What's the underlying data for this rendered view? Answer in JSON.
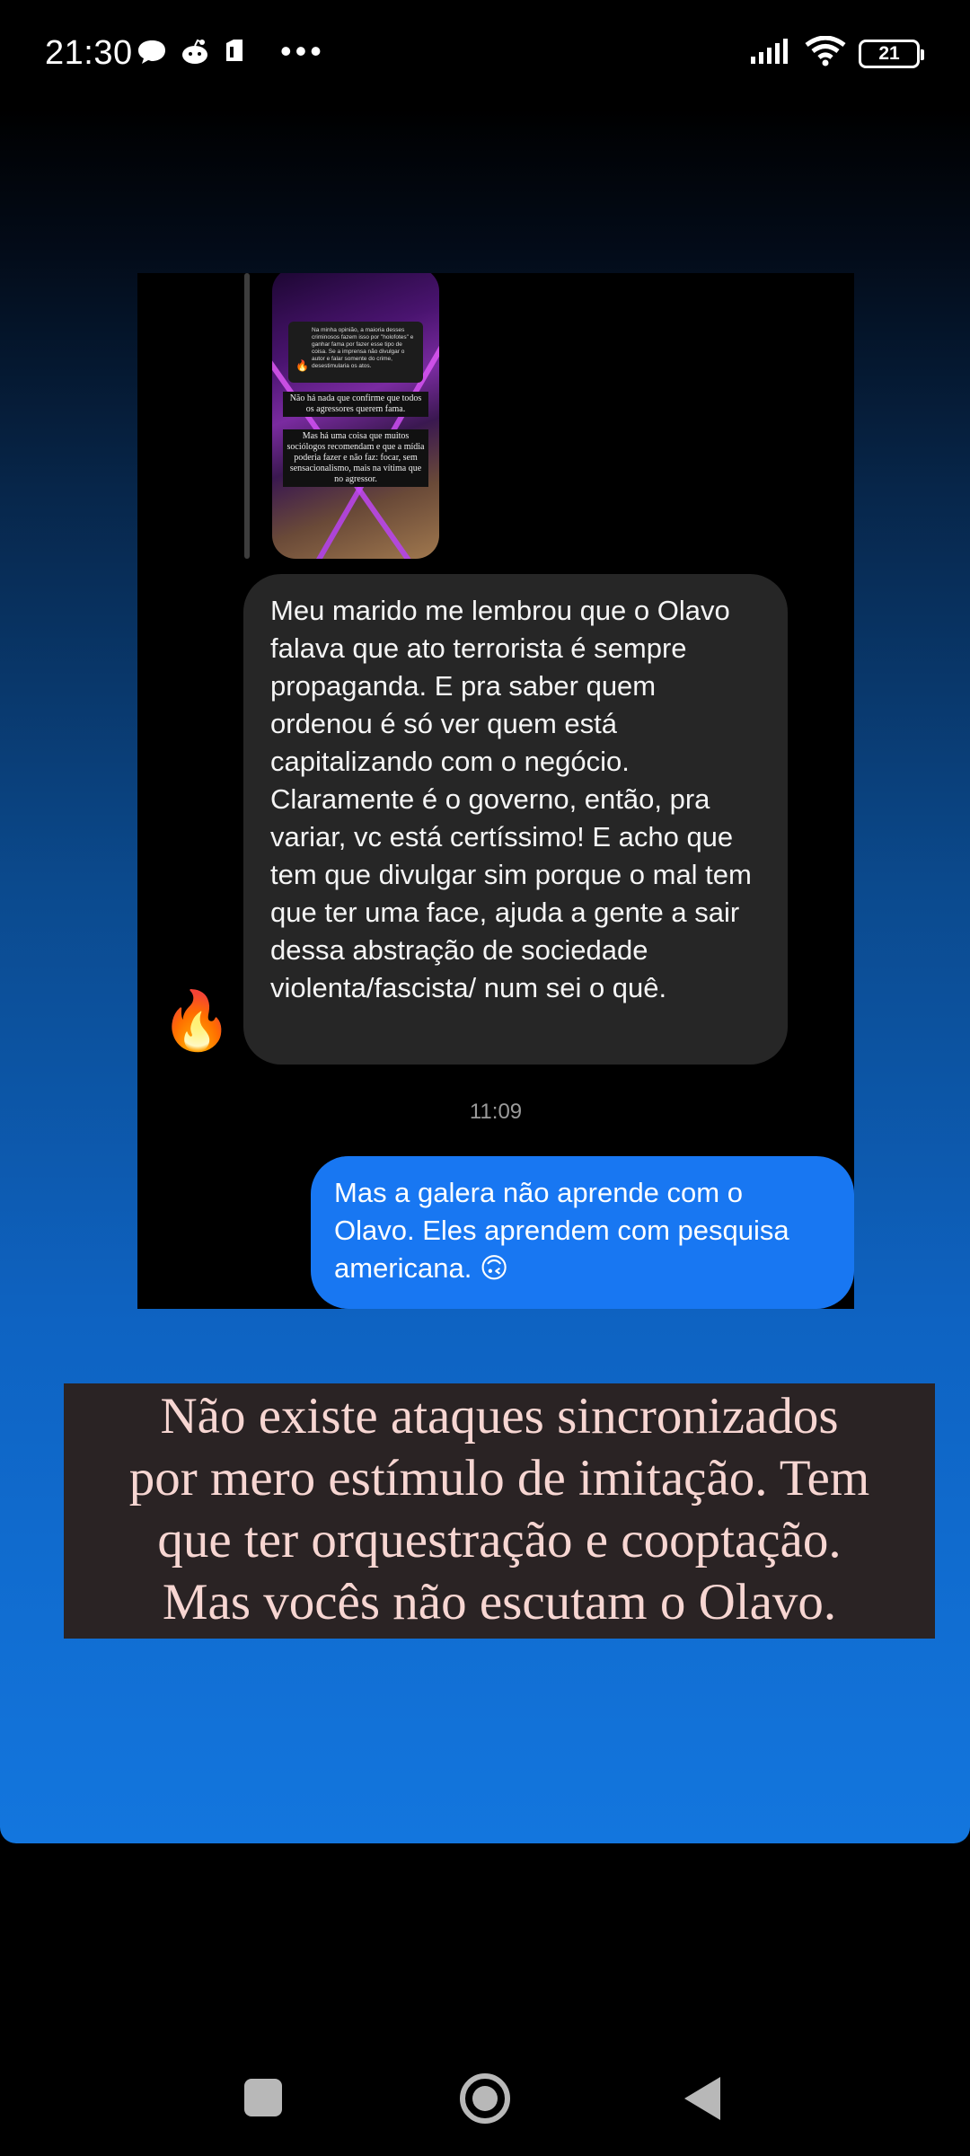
{
  "status_bar": {
    "time": "21:30",
    "notification_icons": [
      "chat-bubble-icon",
      "reddit-icon",
      "sim-card-icon"
    ],
    "more": "•••",
    "battery": "21",
    "signal": "signal-bars-icon",
    "wifi": "wifi-icon"
  },
  "embed": {
    "story_thumbnail": {
      "card_text": "Na minha opinião, a maioria desses criminosos fazem isso por \"holofotes\" e ganhar fama por fazer esse tipo de coisa. Se a imprensa não divulgar o autor e falar somente do crime, desestimularia os atos.",
      "caption_1": "Não há nada que confirme que todos os agressores querem fama.",
      "caption_2": "Mas há uma coisa que muitos sociólogos recomendam e que a mídia poderia fazer e não faz: focar, sem sensacionalismo, mais na vítima que no agressor."
    },
    "received_message": "Meu marido me lembrou que o Olavo falava que ato terrorista é sempre propaganda. E pra saber quem ordenou é só ver quem está capitalizando com o negócio. Claramente é o governo, então, pra variar, vc está certíssimo! E acho que tem que divulgar sim porque o mal tem que ter uma face, ajuda a gente a sair dessa abstração de sociedade violenta/fascista/ num sei o quê.",
    "avatar_emoji": "🔥",
    "timestamp": "11:09",
    "sent_message": "Mas a galera não aprende com o Olavo. Eles aprendem com pesquisa americana. 🙃"
  },
  "caption": {
    "line_1": "Não existe ataques sincronizados",
    "line_2": "por mero estímulo de imitação. Tem",
    "line_3": "que ter orquestração e cooptação.",
    "line_4": "Mas vocês não escutam o Olavo."
  },
  "colors": {
    "sent_bubble": "#1877f2",
    "received_bubble": "#262626",
    "caption_bg": "#2a2324",
    "caption_text": "#f7d6d2"
  }
}
